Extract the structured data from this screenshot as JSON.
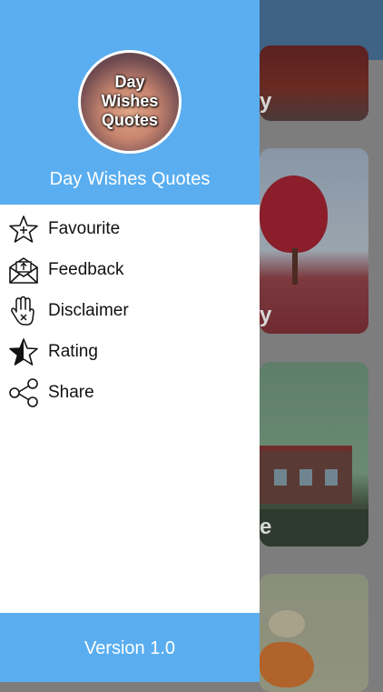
{
  "background": {
    "cards": [
      {
        "word": "y"
      },
      {
        "word": "y"
      },
      {
        "word": "e"
      },
      {
        "word": ""
      }
    ]
  },
  "drawer": {
    "logo_lines": [
      "Day",
      "Wishes",
      "Quotes"
    ],
    "app_title": "Day Wishes Quotes",
    "menu": [
      {
        "label": "Favourite",
        "icon": "star-outline-icon"
      },
      {
        "label": "Feedback",
        "icon": "envelope-upload-icon"
      },
      {
        "label": "Disclaimer",
        "icon": "hand-stop-icon"
      },
      {
        "label": "Rating",
        "icon": "star-half-icon"
      },
      {
        "label": "Share",
        "icon": "share-icon"
      }
    ],
    "version": "Version 1.0"
  },
  "colors": {
    "drawer_accent": "#5aaef0",
    "app_header_dimmed": "#3f6384",
    "overlay": "#7d7d7d"
  }
}
